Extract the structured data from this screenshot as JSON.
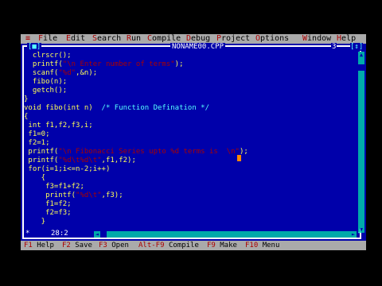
{
  "menu": {
    "system": "≡",
    "items": [
      {
        "hot": "F",
        "rest": "ile"
      },
      {
        "hot": "E",
        "rest": "dit"
      },
      {
        "hot": "S",
        "rest": "earch"
      },
      {
        "hot": "R",
        "rest": "un"
      },
      {
        "hot": "C",
        "rest": "ompile"
      },
      {
        "hot": "D",
        "rest": "ebug"
      },
      {
        "hot": "P",
        "rest": "roject"
      },
      {
        "hot": "O",
        "rest": "ptions"
      },
      {
        "hot": "W",
        "rest": "indow"
      },
      {
        "hot": "H",
        "rest": "elp"
      }
    ]
  },
  "window": {
    "close_box": "[■]",
    "title": "NONAME00.CPP",
    "number": "3",
    "zoom_box": "[↕]"
  },
  "code": {
    "lines": [
      [
        {
          "t": "  clrscr();"
        }
      ],
      [
        {
          "t": "  printf("
        },
        {
          "t": "\"\\n Enter number of terms\"",
          "c": "str"
        },
        {
          "t": ");"
        }
      ],
      [
        {
          "t": "  scanf("
        },
        {
          "t": "\"%d\"",
          "c": "str"
        },
        {
          "t": ",&n);"
        }
      ],
      [
        {
          "t": "  fibo(n);"
        }
      ],
      [
        {
          "t": "  getch();"
        }
      ],
      [
        {
          "t": "}"
        }
      ],
      [
        {
          "t": "void fibo(int n)  "
        },
        {
          "t": "/* Function Defination */",
          "c": "cmt"
        }
      ],
      [
        {
          "t": "{"
        }
      ],
      [
        {
          "t": " int f1,f2,f3,i;"
        }
      ],
      [
        {
          "t": " f1=0;"
        }
      ],
      [
        {
          "t": " f2=1;"
        }
      ],
      [
        {
          "t": " printf("
        },
        {
          "t": "\"\\n Fibonacci Series upto %d terms is  \\n\"",
          "c": "str"
        },
        {
          "t": ");"
        }
      ],
      [
        {
          "t": " printf("
        },
        {
          "t": "\"%d\\t%d\\t\"",
          "c": "str"
        },
        {
          "t": ",f1,f2);"
        }
      ],
      [
        {
          "t": " for(i=1;i<=n-2;i++)"
        }
      ],
      [
        {
          "t": "    {"
        }
      ],
      [
        {
          "t": "     f3=f1+f2;"
        }
      ],
      [
        {
          "t": "     printf("
        },
        {
          "t": "\"%d\\t\"",
          "c": "str"
        },
        {
          "t": ",f3);"
        }
      ],
      [
        {
          "t": "     f1=f2;"
        }
      ],
      [
        {
          "t": "     f2=f3;"
        }
      ],
      [
        {
          "t": "    }"
        }
      ]
    ]
  },
  "status": {
    "modified": "*",
    "cursor_pos": "28:2"
  },
  "scrollbars": {
    "up": "▲",
    "down": "▼",
    "left": "◄",
    "right": "►",
    "resize": "┘"
  },
  "fkeys": [
    {
      "key": "F1",
      "label": "Help"
    },
    {
      "key": "F2",
      "label": "Save"
    },
    {
      "key": "F3",
      "label": "Open"
    },
    {
      "key": "Alt-F9",
      "label": "Compile"
    },
    {
      "key": "F9",
      "label": "Make"
    },
    {
      "key": "F10",
      "label": "Menu"
    }
  ],
  "colors": {
    "background": "#0000aa",
    "menu_bg": "#aaaaaa",
    "code_text": "#ffff55",
    "string": "#aa0000",
    "comment": "#55ffff",
    "scrollbar": "#00aaaa"
  }
}
